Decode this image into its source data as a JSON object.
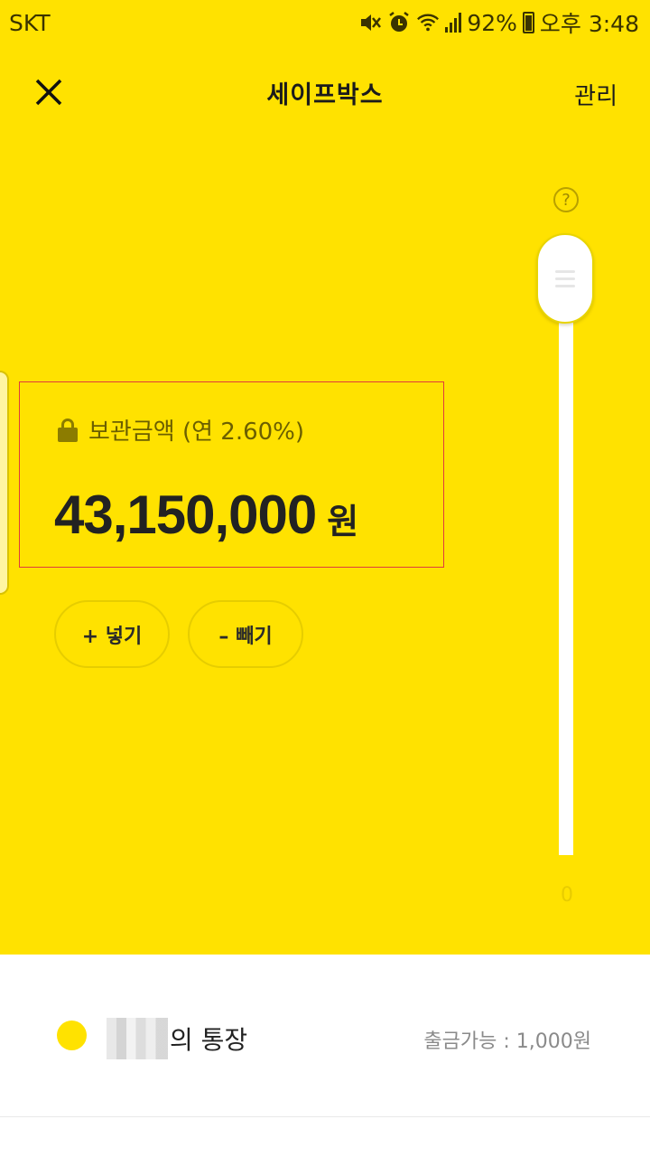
{
  "status_bar": {
    "carrier": "SKT",
    "battery": "92%",
    "time": "오후 3:48",
    "icons": [
      "mute-icon",
      "alarm-icon",
      "wifi-icon",
      "signal-icon",
      "battery-icon"
    ]
  },
  "nav": {
    "close_icon": "close-icon",
    "title": "세이프박스",
    "manage_label": "관리"
  },
  "amount": {
    "label": "보관금액 (연 2.60%)",
    "value": "43,150,000",
    "unit": "원"
  },
  "actions": {
    "deposit_label": "+ 넣기",
    "withdraw_label": "– 빼기"
  },
  "slider": {
    "help": "?",
    "min_label": "0",
    "level": 1.0
  },
  "account": {
    "name_suffix": "의 통장",
    "withdrawable": "출금가능 : 1,000원"
  },
  "colors": {
    "background": "#ffe200",
    "accent_dot": "#ffe200",
    "highlight_border": "#e03c3c"
  }
}
